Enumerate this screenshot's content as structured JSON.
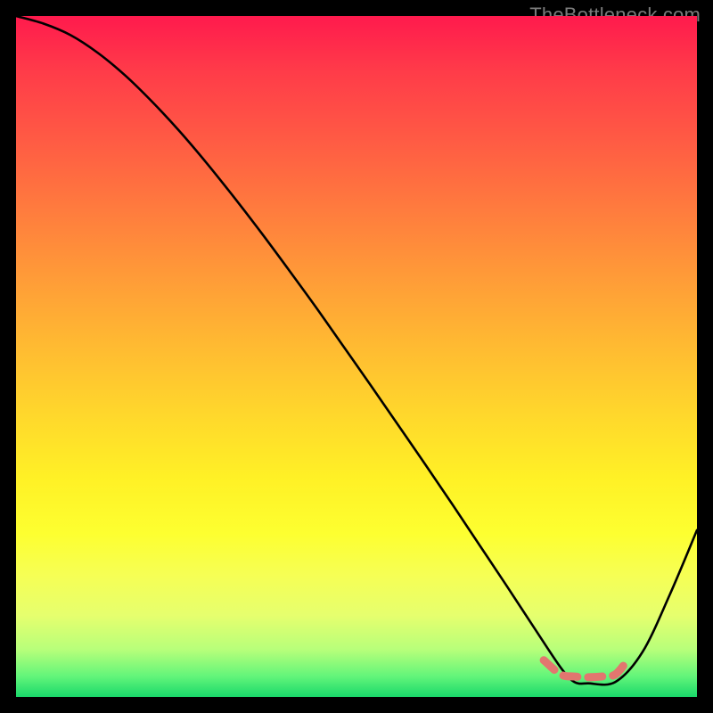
{
  "watermark": "TheBottleneck.com",
  "colors": {
    "background": "#000000",
    "gradient_top": "#ff1a4d",
    "gradient_bottom": "#19d86a",
    "curve": "#000000",
    "marker": "#e2766f"
  },
  "chart_data": {
    "type": "line",
    "title": "",
    "xlabel": "",
    "ylabel": "",
    "xlim": [
      0,
      100
    ],
    "ylim": [
      0,
      100
    ],
    "grid": false,
    "series": [
      {
        "name": "bottleneck-curve",
        "x": [
          0,
          4,
          8,
          12,
          16,
          20,
          24,
          28,
          32,
          36,
          40,
          44,
          48,
          52,
          56,
          60,
          64,
          68,
          72,
          76,
          80,
          82,
          84,
          88,
          92,
          96,
          100
        ],
        "y": [
          100,
          98.9,
          97.2,
          94.6,
          91.3,
          87.4,
          83.1,
          78.4,
          73.4,
          68.2,
          62.8,
          57.3,
          51.6,
          45.9,
          40.1,
          34.3,
          28.4,
          22.4,
          16.4,
          10.3,
          4.3,
          2.2,
          2.0,
          2.2,
          6.6,
          15.0,
          24.5
        ]
      },
      {
        "name": "optimal-band-marker",
        "x": [
          77.5,
          80,
          82,
          84,
          86,
          88,
          89.8
        ],
        "y": [
          5.4,
          3.3,
          3.0,
          2.9,
          3.0,
          3.3,
          5.4
        ]
      }
    ],
    "annotations": []
  }
}
